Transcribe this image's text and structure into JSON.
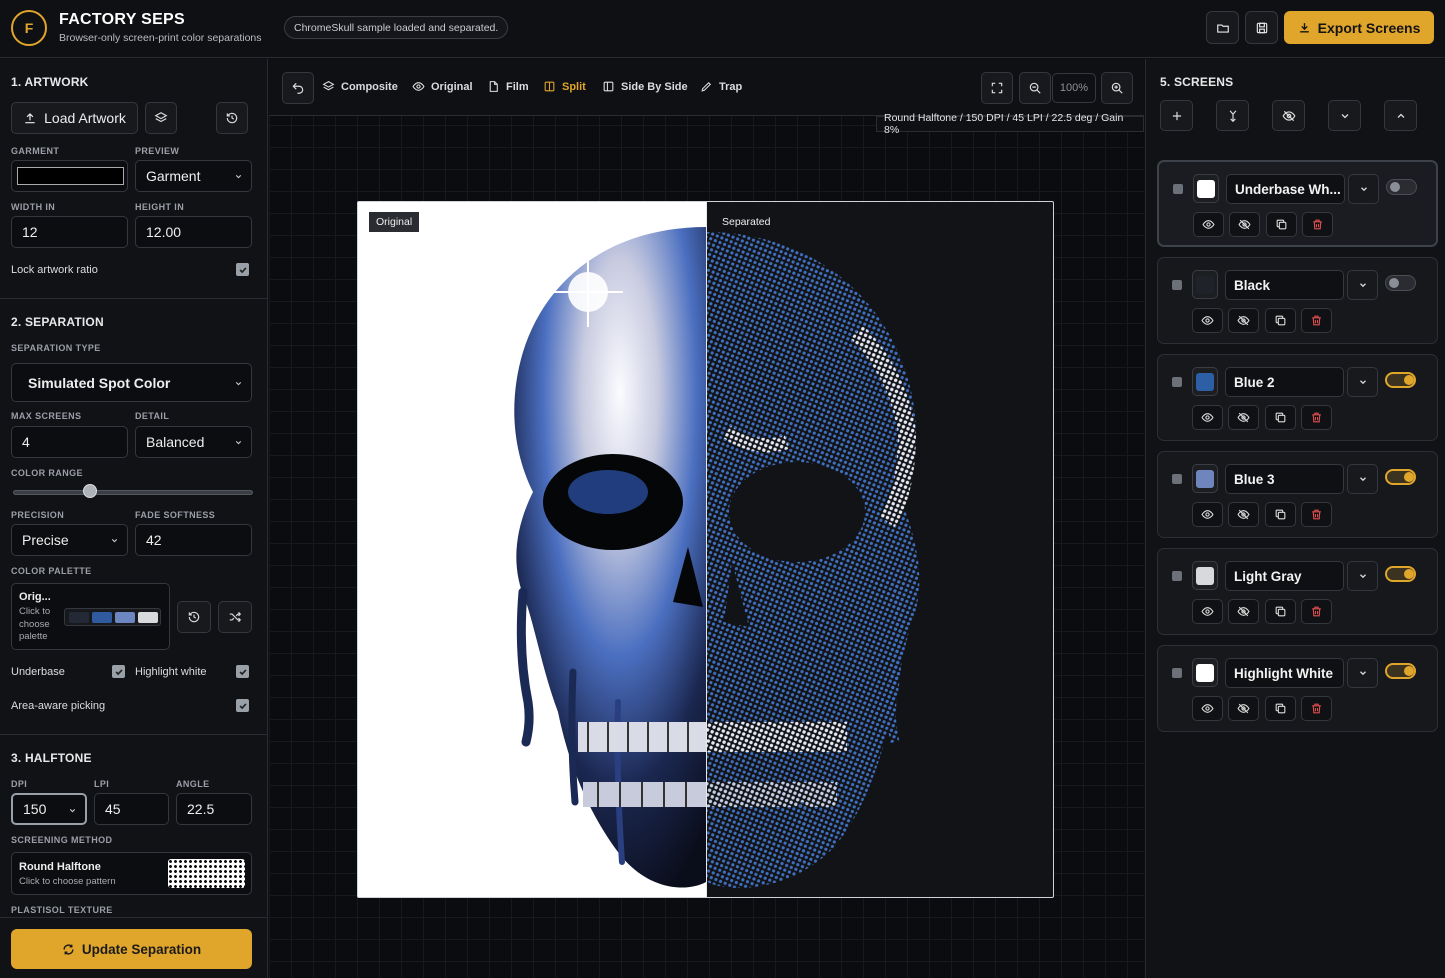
{
  "header": {
    "logo_letter": "F",
    "title": "FACTORY SEPS",
    "subtitle": "Browser-only screen-print color separations",
    "status": "ChromeSkull sample loaded and separated.",
    "export_label": "Export Screens"
  },
  "artwork": {
    "title": "1. ARTWORK",
    "load_label": "Load Artwork",
    "garment_label": "GARMENT",
    "preview_label": "PREVIEW",
    "preview_value": "Garment",
    "width_label": "WIDTH IN",
    "width_value": "12",
    "height_label": "HEIGHT IN",
    "height_value": "12.00",
    "lock_label": "Lock artwork ratio"
  },
  "separation": {
    "title": "2. SEPARATION",
    "type_label": "SEPARATION TYPE",
    "type_value": "Simulated Spot Color",
    "max_screens_label": "MAX SCREENS",
    "max_screens_value": "4",
    "detail_label": "DETAIL",
    "detail_value": "Balanced",
    "color_range_label": "COLOR RANGE",
    "color_range_level": 0.32,
    "precision_label": "PRECISION",
    "precision_value": "Precise",
    "fade_label": "FADE SOFTNESS",
    "fade_value": "42",
    "palette_label": "COLOR PALETTE",
    "palette_name": "Orig...",
    "palette_hint": "Click to choose palette",
    "palette_colors": [
      "#232a35",
      "#2f5aa0",
      "#6b86c0",
      "#d8d9dc"
    ],
    "underbase_label": "Underbase",
    "highlight_label": "Highlight white",
    "area_label": "Area-aware picking"
  },
  "halftone": {
    "title": "3. HALFTONE",
    "dpi_label": "DPI",
    "dpi_value": "150",
    "lpi_label": "LPI",
    "lpi_value": "45",
    "angle_label": "ANGLE",
    "angle_value": "22.5",
    "method_label": "SCREENING METHOD",
    "method_name": "Round Halftone",
    "method_hint": "Click to choose pattern",
    "texture_label": "PLASTISOL TEXTURE"
  },
  "update_label": "Update Separation",
  "toolbar": {
    "composite": "Composite",
    "original": "Original",
    "film": "Film",
    "split": "Split",
    "side_by_side": "Side By Side",
    "trap": "Trap",
    "zoom": "100%",
    "info": "Round Halftone / 150 DPI / 45 LPI / 22.5 deg / Gain 8%"
  },
  "stage": {
    "left_tag": "Original",
    "right_tag": "Separated"
  },
  "screens": {
    "title": "5. SCREENS",
    "items": [
      {
        "name": "Underbase Wh...",
        "color": "#ffffff",
        "enabled": false
      },
      {
        "name": "Black",
        "color": "#1f2228",
        "enabled": false
      },
      {
        "name": "Blue 2",
        "color": "#2d5fa6",
        "enabled": true
      },
      {
        "name": "Blue 3",
        "color": "#6e86bd",
        "enabled": true
      },
      {
        "name": "Light Gray",
        "color": "#d8d9dc",
        "enabled": true
      },
      {
        "name": "Highlight White",
        "color": "#ffffff",
        "enabled": true
      }
    ]
  },
  "colors": {
    "accent": "#e0a52b",
    "delete": "#e05050"
  }
}
